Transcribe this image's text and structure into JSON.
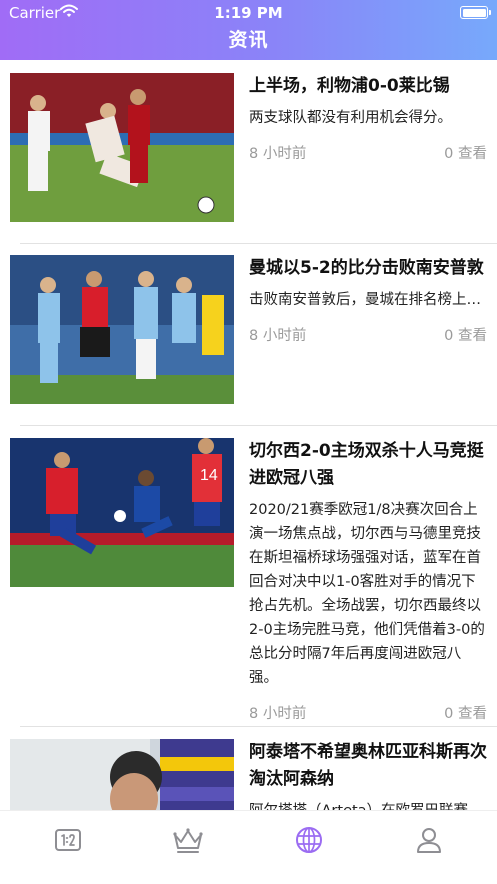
{
  "status_bar": {
    "carrier": "Carrier",
    "time": "1:19 PM"
  },
  "nav": {
    "title": "资讯"
  },
  "articles": [
    {
      "title": "上半场，利物浦0-0莱比锡",
      "summary": "两支球队都没有利用机会得分。",
      "time_ago": "8 小时前",
      "views": "0 查看"
    },
    {
      "title": "曼城以5-2的比分击败南安普敦",
      "summary": "击败南安普敦后，曼城在排名榜上领先",
      "time_ago": "8 小时前",
      "views": "0 查看"
    },
    {
      "title": "切尔西2-0主场双杀十人马竞挺进欧冠八强",
      "summary": "2020/21赛季欧冠1/8决赛次回合上演一场焦点战，切尔西与马德里竞技在斯坦福桥球场强强对话，蓝军在首回合对决中以1-0客胜对手的情况下抢占先机。全场战罢，切尔西最终以2-0主场完胜马竞，他们凭借着3-0的总比分时隔7年后再度闯进欧冠八强。",
      "time_ago": "8 小时前",
      "views": "0 查看"
    },
    {
      "title": "阿泰塔不希望奥林匹亚科斯再次淘汰阿森纳",
      "summary": "阿尔塔塔（Arteta）在欧罗巴联赛",
      "time_ago": "",
      "views": ""
    }
  ],
  "tabbar": {
    "items": [
      {
        "icon": "score-icon",
        "active": false
      },
      {
        "icon": "crown-icon",
        "active": false
      },
      {
        "icon": "globe-icon",
        "active": true
      },
      {
        "icon": "profile-icon",
        "active": false
      }
    ],
    "active_color": "#9b6cf2",
    "inactive_color": "#8e8e93"
  },
  "colors": {
    "header_gradient_start": "#a06cf6",
    "header_gradient_end": "#77a9fb"
  }
}
